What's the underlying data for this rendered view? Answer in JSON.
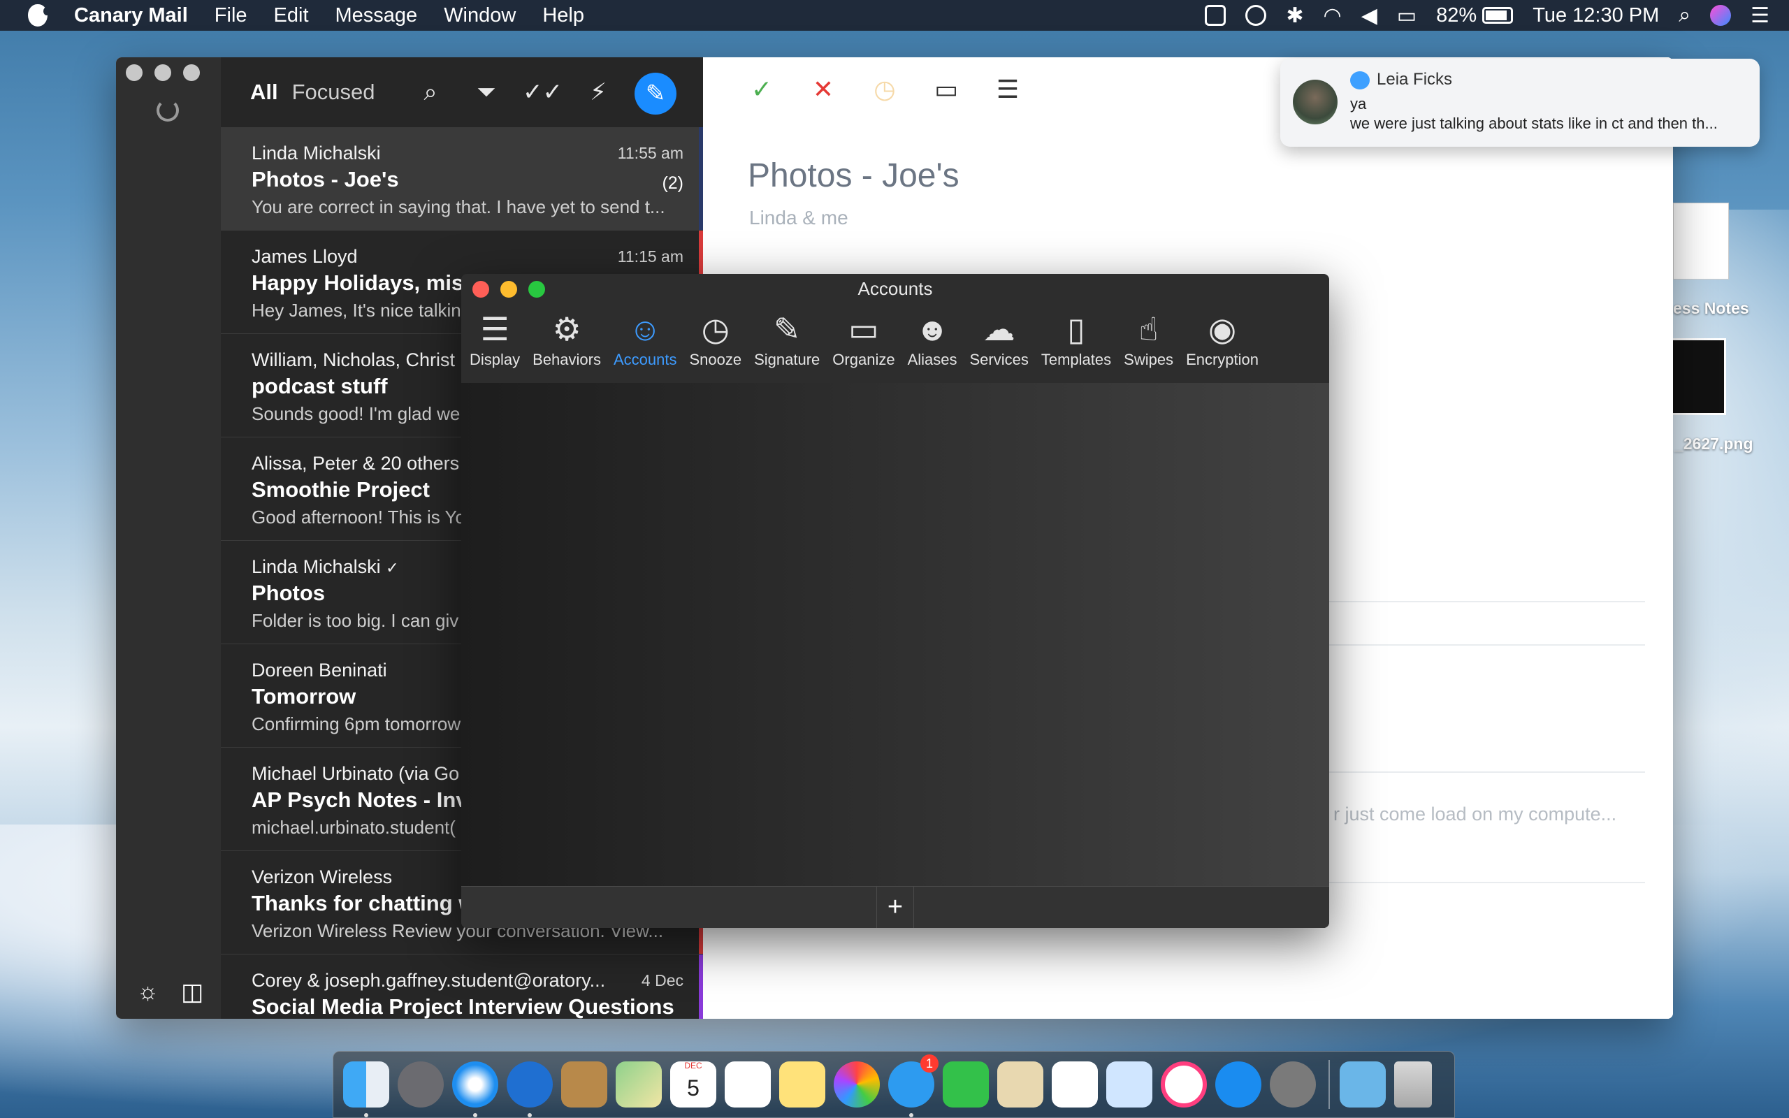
{
  "menubar": {
    "app_name": "Canary Mail",
    "menus": [
      "File",
      "Edit",
      "Message",
      "Window",
      "Help"
    ],
    "battery": "82%",
    "clock": "Tue 12:30 PM"
  },
  "list": {
    "tab_all": "All",
    "tab_focused": "Focused",
    "messages": [
      {
        "sender": "Linda Michalski",
        "time": "11:55 am",
        "subject": "Photos - Joe's",
        "count": "(2)",
        "preview": "You are correct in saying that. I have yet to send t..."
      },
      {
        "sender": "James Lloyd",
        "time": "11:15 am",
        "subject": "Happy Holidays, misc",
        "count": "",
        "preview": "Hey James, It's nice talkin"
      },
      {
        "sender": "William, Nicholas, Christ",
        "time": "",
        "subject": "podcast stuff",
        "count": "",
        "preview": "Sounds good! I'm glad we"
      },
      {
        "sender": "Alissa, Peter & 20 others",
        "time": "",
        "subject": "Smoothie Project",
        "count": "",
        "preview": "Good afternoon! This is Yo"
      },
      {
        "sender": "Linda Michalski",
        "time": "",
        "subject": "Photos",
        "count": "",
        "preview": "Folder is too big. I can giv"
      },
      {
        "sender": "Doreen Beninati",
        "time": "",
        "subject": "Tomorrow",
        "count": "",
        "preview": "Confirming 6pm tomorrow"
      },
      {
        "sender": "Michael Urbinato (via Go",
        "time": "",
        "subject": "AP Psych Notes - Inv",
        "count": "",
        "preview": "michael.urbinato.student("
      },
      {
        "sender": "Verizon Wireless",
        "time": "",
        "subject": "Thanks for chatting w",
        "count": "",
        "preview": "Verizon Wireless Review your conversation. View..."
      },
      {
        "sender": "Corey & joseph.gaffney.student@oratory...",
        "time": "4 Dec",
        "subject": "Social Media Project Interview Questions...",
        "count": "",
        "preview": ""
      }
    ]
  },
  "reader": {
    "title": "Photos - Joe's",
    "participants": "Linda & me",
    "faded_text": "r just come load on my compute..."
  },
  "prefs": {
    "window_title": "Accounts",
    "tabs": [
      "Display",
      "Behaviors",
      "Accounts",
      "Snooze",
      "Signature",
      "Organize",
      "Aliases",
      "Services",
      "Templates",
      "Swipes",
      "Encryption"
    ],
    "add_label": "+"
  },
  "notification": {
    "name": "Leia Ficks",
    "line1": "ya",
    "line2": "we were just talking about stats like in ct and then th..."
  },
  "desktop": {
    "icon1_label": "ess Notes",
    "icon2_label": "_2627.png"
  },
  "dock": {
    "calendar_day": "5",
    "calendar_month": "DEC",
    "messages_badge": "1"
  },
  "colors": {
    "accent": "#1a8cff",
    "check": "#4caf50",
    "cross": "#e53935"
  }
}
